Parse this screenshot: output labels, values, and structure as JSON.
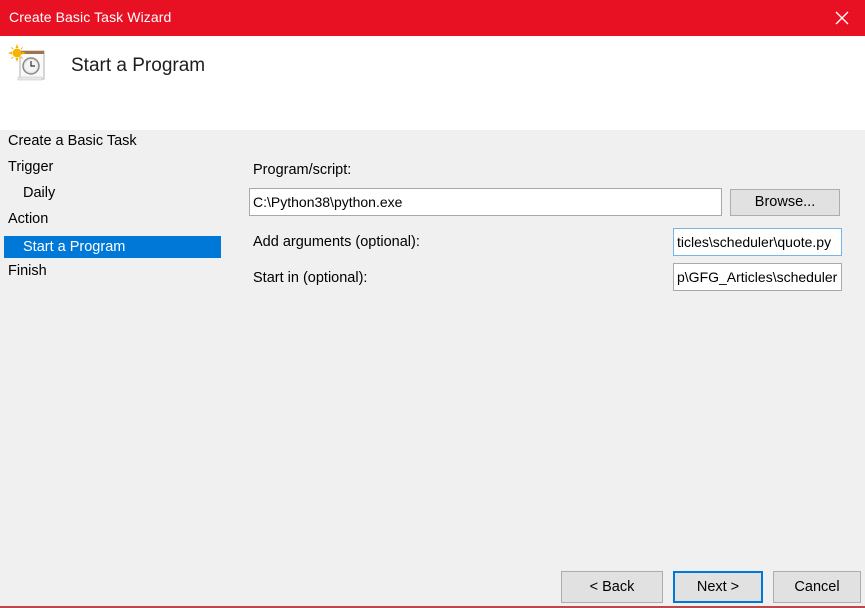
{
  "window": {
    "title": "Create Basic Task Wizard",
    "close_icon": "close-icon",
    "accent_color": "#e81123"
  },
  "header": {
    "icon": "task-scheduler-clock-icon",
    "heading": "Start a Program"
  },
  "sidebar": {
    "items": [
      {
        "label": "Create a Basic Task",
        "level": 0,
        "selected": false
      },
      {
        "label": "Trigger",
        "level": 0,
        "selected": false
      },
      {
        "label": "Daily",
        "level": 1,
        "selected": false
      },
      {
        "label": "Action",
        "level": 0,
        "selected": false
      },
      {
        "label": "Start a Program",
        "level": 1,
        "selected": true
      },
      {
        "label": "Finish",
        "level": 0,
        "selected": false
      }
    ],
    "selection_color": "#0078d7"
  },
  "form": {
    "program_label": "Program/script:",
    "program_value": "C:\\Python38\\python.exe",
    "browse_label": "Browse...",
    "arguments_label": "Add arguments (optional):",
    "arguments_value": "ticles\\scheduler\\quote.py",
    "start_in_label": "Start in (optional):",
    "start_in_value": "p\\GFG_Articles\\scheduler"
  },
  "footer": {
    "back_label": "< Back",
    "next_label": "Next >",
    "cancel_label": "Cancel"
  }
}
